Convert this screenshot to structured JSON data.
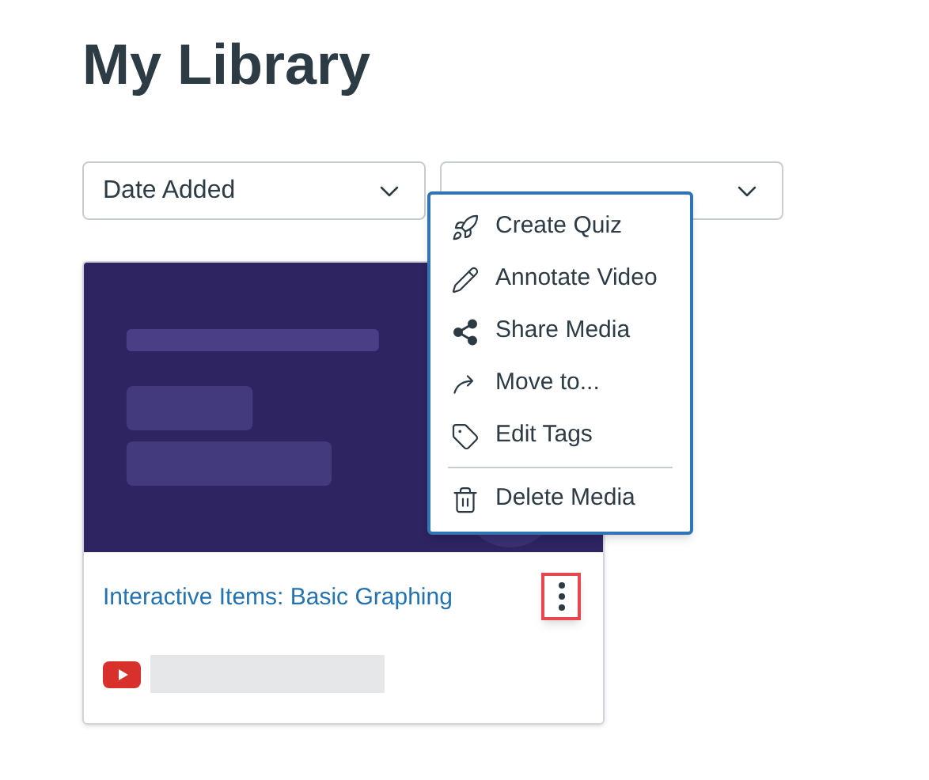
{
  "page": {
    "title": "My Library"
  },
  "filters": [
    {
      "kind": "dropdown",
      "value": "Date Added"
    },
    {
      "kind": "dropdown"
    }
  ],
  "media": {
    "title": "Interactive Items: Basic Graphing"
  },
  "menu": {
    "open": true,
    "items": [
      {
        "label": "Create Quiz",
        "separated": false
      },
      {
        "label": "Annotate Video",
        "separated": false
      },
      {
        "label": "Share Media",
        "separated": false
      },
      {
        "label": "Move to...",
        "separated": false
      },
      {
        "label": "Edit Tags",
        "separated": false
      },
      {
        "label": "Delete Media",
        "separated": true
      }
    ]
  }
}
